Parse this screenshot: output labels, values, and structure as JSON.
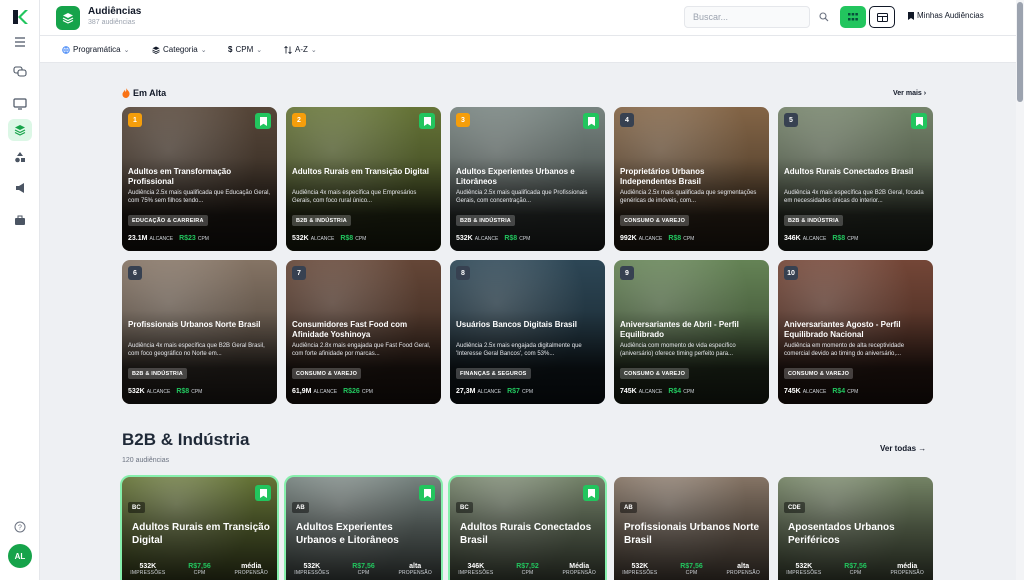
{
  "header": {
    "title": "Audiências",
    "subtitle": "387 audiências",
    "search_placeholder": "Buscar...",
    "my_audiences": "Minhas Audiências"
  },
  "filters": [
    {
      "label": "Programática",
      "icon": "globe-icon"
    },
    {
      "label": "Categoria",
      "icon": "layers-icon"
    },
    {
      "label": "CPM",
      "icon": "dollar-icon"
    },
    {
      "label": "A-Z",
      "icon": "sort-icon"
    }
  ],
  "sidebar": {
    "avatar": "AL"
  },
  "hot": {
    "title": "Em Alta",
    "see_more": "Ver mais",
    "cards": [
      {
        "rank": "1",
        "title": "Adultos em Transformação Profissional",
        "desc": "Audiência 2.5x mais qualificada que Educação Geral, com 75% sem filhos tendo...",
        "tag": "EDUCAÇÃO & CARREIRA",
        "reach": "23.1M",
        "reach_label": "ALCANCE",
        "cpm": "R$23",
        "cpm_label": "CPM",
        "bookmark": true,
        "bg": "#5b4a3c",
        "rank_color": "#f59e0b"
      },
      {
        "rank": "2",
        "title": "Adultos Rurais em Transição Digital",
        "desc": "Audiência 4x mais específica que Empresários Gerais, com foco rural único...",
        "tag": "B2B & INDÚSTRIA",
        "reach": "532K",
        "reach_label": "ALCANCE",
        "cpm": "R$8",
        "cpm_label": "CPM",
        "bookmark": true,
        "bg": "#6b7a3a",
        "rank_color": "#f59e0b"
      },
      {
        "rank": "3",
        "title": "Adultos Experientes Urbanos e Litorâneos",
        "desc": "Audiência 2.5x mais qualificada que Profissionais Gerais, com concentração...",
        "tag": "B2B & INDÚSTRIA",
        "reach": "532K",
        "reach_label": "ALCANCE",
        "cpm": "R$8",
        "cpm_label": "CPM",
        "bookmark": true,
        "bg": "#7d8a86",
        "rank_color": "#f59e0b"
      },
      {
        "rank": "4",
        "title": "Proprietários Urbanos Independentes Brasil",
        "desc": "Audiência 2.5x mais qualificada que segmentações genéricas de imóveis, com...",
        "tag": "CONSUMO & VAREJO",
        "reach": "992K",
        "reach_label": "ALCANCE",
        "cpm": "R$8",
        "cpm_label": "CPM",
        "bookmark": false,
        "bg": "#8a6a4a",
        "rank_color": "#374151"
      },
      {
        "rank": "5",
        "title": "Adultos Rurais Conectados Brasil",
        "desc": "Audiência 4x mais específica que B2B Geral, focada em necessidades únicas do interior...",
        "tag": "B2B & INDÚSTRIA",
        "reach": "346K",
        "reach_label": "ALCANCE",
        "cpm": "R$8",
        "cpm_label": "CPM",
        "bookmark": true,
        "bg": "#7b8a70",
        "rank_color": "#374151"
      },
      {
        "rank": "6",
        "title": "Profissionais Urbanos Norte Brasil",
        "desc": "Audiência 4x mais específica que B2B Geral Brasil, com foco geográfico no Norte em...",
        "tag": "B2B & INDÚSTRIA",
        "reach": "532K",
        "reach_label": "ALCANCE",
        "cpm": "R$8",
        "cpm_label": "CPM",
        "bookmark": false,
        "bg": "#8c7a6a",
        "rank_color": "#374151"
      },
      {
        "rank": "7",
        "title": "Consumidores Fast Food com Afinidade Yoshinoya",
        "desc": "Audiência 2.8x mais engajada que Fast Food Geral, com forte afinidade por marcas...",
        "tag": "CONSUMO & VAREJO",
        "reach": "61,9M",
        "reach_label": "ALCANCE",
        "cpm": "R$26",
        "cpm_label": "CPM",
        "bookmark": false,
        "bg": "#6a4a3a",
        "rank_color": "#374151"
      },
      {
        "rank": "8",
        "title": "Usuários Bancos Digitais Brasil",
        "desc": "Audiência 2.5x mais engajada digitalmente que 'Interesse Geral Bancos', com 53%...",
        "tag": "FINANÇAS & SEGUROS",
        "reach": "27,3M",
        "reach_label": "ALCANCE",
        "cpm": "R$7",
        "cpm_label": "CPM",
        "bookmark": false,
        "bg": "#2f4a5a",
        "rank_color": "#374151"
      },
      {
        "rank": "9",
        "title": "Aniversariantes de Abril - Perfil Equilibrado",
        "desc": "Audiência com momento de vida específico (aniversário) oferece timing perfeito para...",
        "tag": "CONSUMO & VAREJO",
        "reach": "745K",
        "reach_label": "ALCANCE",
        "cpm": "R$4",
        "cpm_label": "CPM",
        "bookmark": false,
        "bg": "#6a8a5a",
        "rank_color": "#374151"
      },
      {
        "rank": "10",
        "title": "Aniversariantes Agosto - Perfil Equilibrado Nacional",
        "desc": "Audiência em momento de alta receptividade comercial devido ao timing do aniversário,...",
        "tag": "CONSUMO & VAREJO",
        "reach": "745K",
        "reach_label": "ALCANCE",
        "cpm": "R$4",
        "cpm_label": "CPM",
        "bookmark": false,
        "bg": "#7a4a3a",
        "rank_color": "#374151"
      }
    ]
  },
  "section2": {
    "title": "B2B & Indústria",
    "subtitle": "120 audiências",
    "see_all": "Ver todas →",
    "cards": [
      {
        "seg": "BC",
        "title": "Adultos Rurais em Transição Digital",
        "impressions": "532K",
        "impressions_label": "IMPRESSÕES",
        "cpm": "R$7,56",
        "cpm_label": "CPM",
        "propensity": "média",
        "propensity_label": "PROPENSÃO",
        "bookmark": true,
        "highlight": true,
        "bg": "#6b7a3a"
      },
      {
        "seg": "AB",
        "title": "Adultos Experientes Urbanos e Litorâneos",
        "impressions": "532K",
        "impressions_label": "IMPRESSÕES",
        "cpm": "R$7,56",
        "cpm_label": "CPM",
        "propensity": "alta",
        "propensity_label": "PROPENSÃO",
        "bookmark": true,
        "highlight": true,
        "bg": "#7d8a86"
      },
      {
        "seg": "BC",
        "title": "Adultos Rurais Conectados Brasil",
        "impressions": "346K",
        "impressions_label": "IMPRESSÕES",
        "cpm": "R$7,52",
        "cpm_label": "CPM",
        "propensity": "Média",
        "propensity_label": "PROPENSÃO",
        "bookmark": true,
        "highlight": true,
        "bg": "#7b8a70"
      },
      {
        "seg": "AB",
        "title": "Profissionais Urbanos Norte Brasil",
        "impressions": "532K",
        "impressions_label": "IMPRESSÕES",
        "cpm": "R$7,56",
        "cpm_label": "CPM",
        "propensity": "alta",
        "propensity_label": "PROPENSÃO",
        "bookmark": false,
        "highlight": false,
        "bg": "#8c7a6a"
      },
      {
        "seg": "CDE",
        "title": "Aposentados Urbanos Periféricos",
        "impressions": "532K",
        "impressions_label": "IMPRESSÕES",
        "cpm": "R$7,56",
        "cpm_label": "CPM",
        "propensity": "média",
        "propensity_label": "PROPENSÃO",
        "bookmark": false,
        "highlight": false,
        "bg": "#7a8a6a"
      }
    ]
  }
}
